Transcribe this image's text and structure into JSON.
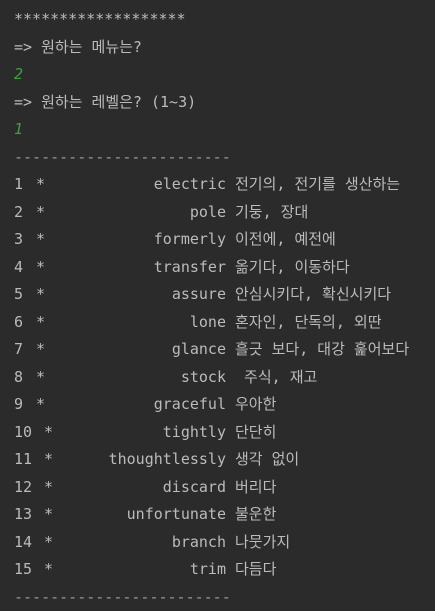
{
  "console": {
    "banner": "*******************",
    "prompt_menu": "=> 원하는 메뉴는?",
    "input_menu": "2",
    "prompt_level": "=> 원하는 레벨은? (1~3)",
    "input_level": "1",
    "separator_top": "------------------------",
    "separator_bottom": "------------------------",
    "star": "*",
    "words": [
      {
        "num": "1",
        "word": "electric",
        "meaning": "전기의, 전기를 생산하는"
      },
      {
        "num": "2",
        "word": "pole",
        "meaning": "기둥, 장대"
      },
      {
        "num": "3",
        "word": "formerly",
        "meaning": "이전에, 예전에"
      },
      {
        "num": "4",
        "word": "transfer",
        "meaning": "옮기다, 이동하다"
      },
      {
        "num": "5",
        "word": "assure",
        "meaning": "안심시키다, 확신시키다"
      },
      {
        "num": "6",
        "word": "lone",
        "meaning": "혼자인, 단독의, 외딴"
      },
      {
        "num": "7",
        "word": "glance",
        "meaning": "흘긋 보다, 대강 훑어보다"
      },
      {
        "num": "8",
        "word": "stock",
        "meaning": " 주식, 재고"
      },
      {
        "num": "9",
        "word": "graceful",
        "meaning": "우아한"
      },
      {
        "num": "10",
        "word": "tightly",
        "meaning": "단단히"
      },
      {
        "num": "11",
        "word": "thoughtlessly",
        "meaning": "생각 없이"
      },
      {
        "num": "12",
        "word": "discard",
        "meaning": "버리다"
      },
      {
        "num": "13",
        "word": "unfortunate",
        "meaning": "불운한"
      },
      {
        "num": "14",
        "word": "branch",
        "meaning": "나뭇가지"
      },
      {
        "num": "15",
        "word": "trim",
        "meaning": "다듬다"
      }
    ]
  }
}
